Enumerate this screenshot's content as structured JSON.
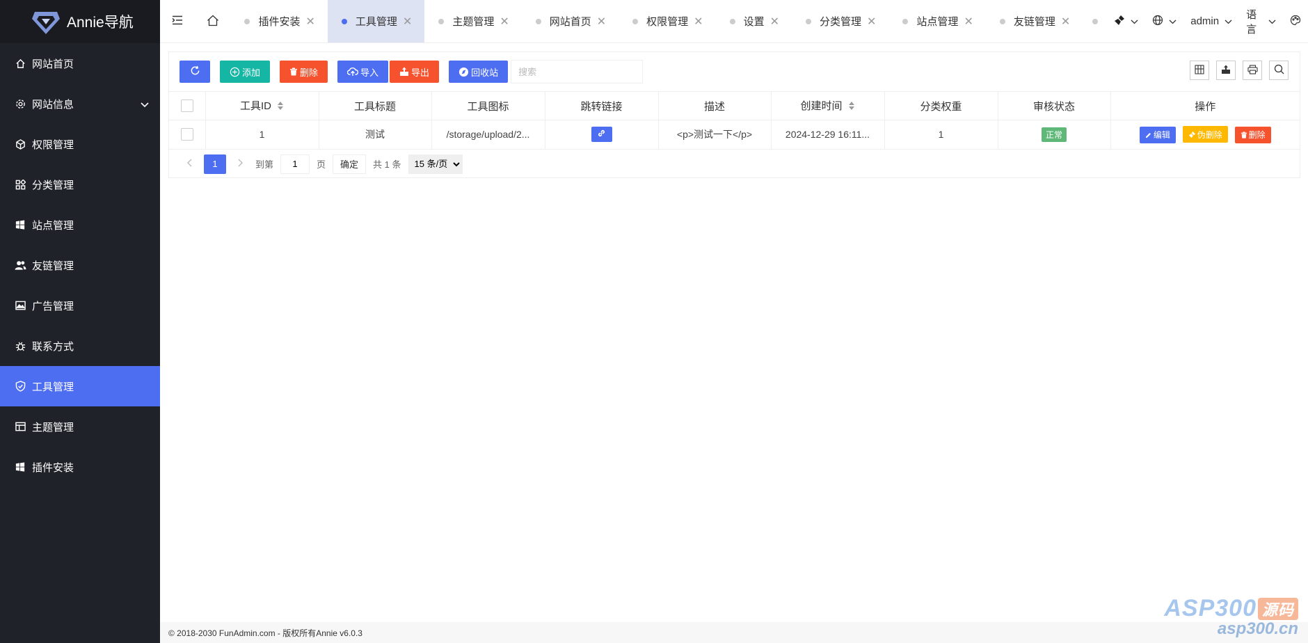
{
  "brand": {
    "name": "Annie导航"
  },
  "sidebar": {
    "items": [
      {
        "label": "网站首页",
        "icon": "home-icon"
      },
      {
        "label": "网站信息",
        "icon": "gear-icon",
        "expandable": true
      },
      {
        "label": "权限管理",
        "icon": "cube-icon"
      },
      {
        "label": "分类管理",
        "icon": "apps-icon"
      },
      {
        "label": "站点管理",
        "icon": "windows-icon"
      },
      {
        "label": "友链管理",
        "icon": "users-icon"
      },
      {
        "label": "广告管理",
        "icon": "image-icon"
      },
      {
        "label": "联系方式",
        "icon": "bug-icon"
      },
      {
        "label": "工具管理",
        "icon": "shield-icon",
        "active": true
      },
      {
        "label": "主题管理",
        "icon": "layout-icon"
      },
      {
        "label": "插件安装",
        "icon": "windows-icon"
      }
    ]
  },
  "topbar": {
    "tabs": [
      {
        "label": "插件安装"
      },
      {
        "label": "工具管理",
        "active": true
      },
      {
        "label": "主题管理"
      },
      {
        "label": "网站首页"
      },
      {
        "label": "权限管理"
      },
      {
        "label": "设置"
      },
      {
        "label": "分类管理"
      },
      {
        "label": "站点管理"
      },
      {
        "label": "友链管理"
      }
    ],
    "user": "admin",
    "language": "语言"
  },
  "toolbar": {
    "add": "添加",
    "delete": "删除",
    "import": "导入",
    "export": "导出",
    "recycle": "回收站",
    "search_placeholder": "搜索"
  },
  "table": {
    "headers": [
      "工具ID",
      "工具标题",
      "工具图标",
      "跳转链接",
      "描述",
      "创建时间",
      "分类权重",
      "审核状态",
      "操作"
    ],
    "rows": [
      {
        "id": "1",
        "title": "测试",
        "icon_path": "/storage/upload/2...",
        "description": "<p>测试一下</p>",
        "created": "2024-12-29 16:11...",
        "weight": "1",
        "status": "正常",
        "edit": "编辑",
        "soft_delete": "伪删除",
        "delete": "删除"
      }
    ]
  },
  "pager": {
    "current": "1",
    "goto": "到第",
    "page_value": "1",
    "page_unit": "页",
    "confirm": "确定",
    "total": "共 1 条",
    "per_page": "15 条/页"
  },
  "footer": {
    "text": "© 2018-2030 FunAdmin.com - 版权所有Annie v6.0.3"
  },
  "watermark": {
    "top": "ASP300",
    "top_cn": "源码",
    "bottom": "asp300.cn"
  },
  "colors": {
    "accent": "#4e6ef2",
    "sidebar": "#20222a",
    "teal": "#16b6a4",
    "orange": "#f5522d",
    "yellow": "#ffb800",
    "green": "#5fb878"
  }
}
